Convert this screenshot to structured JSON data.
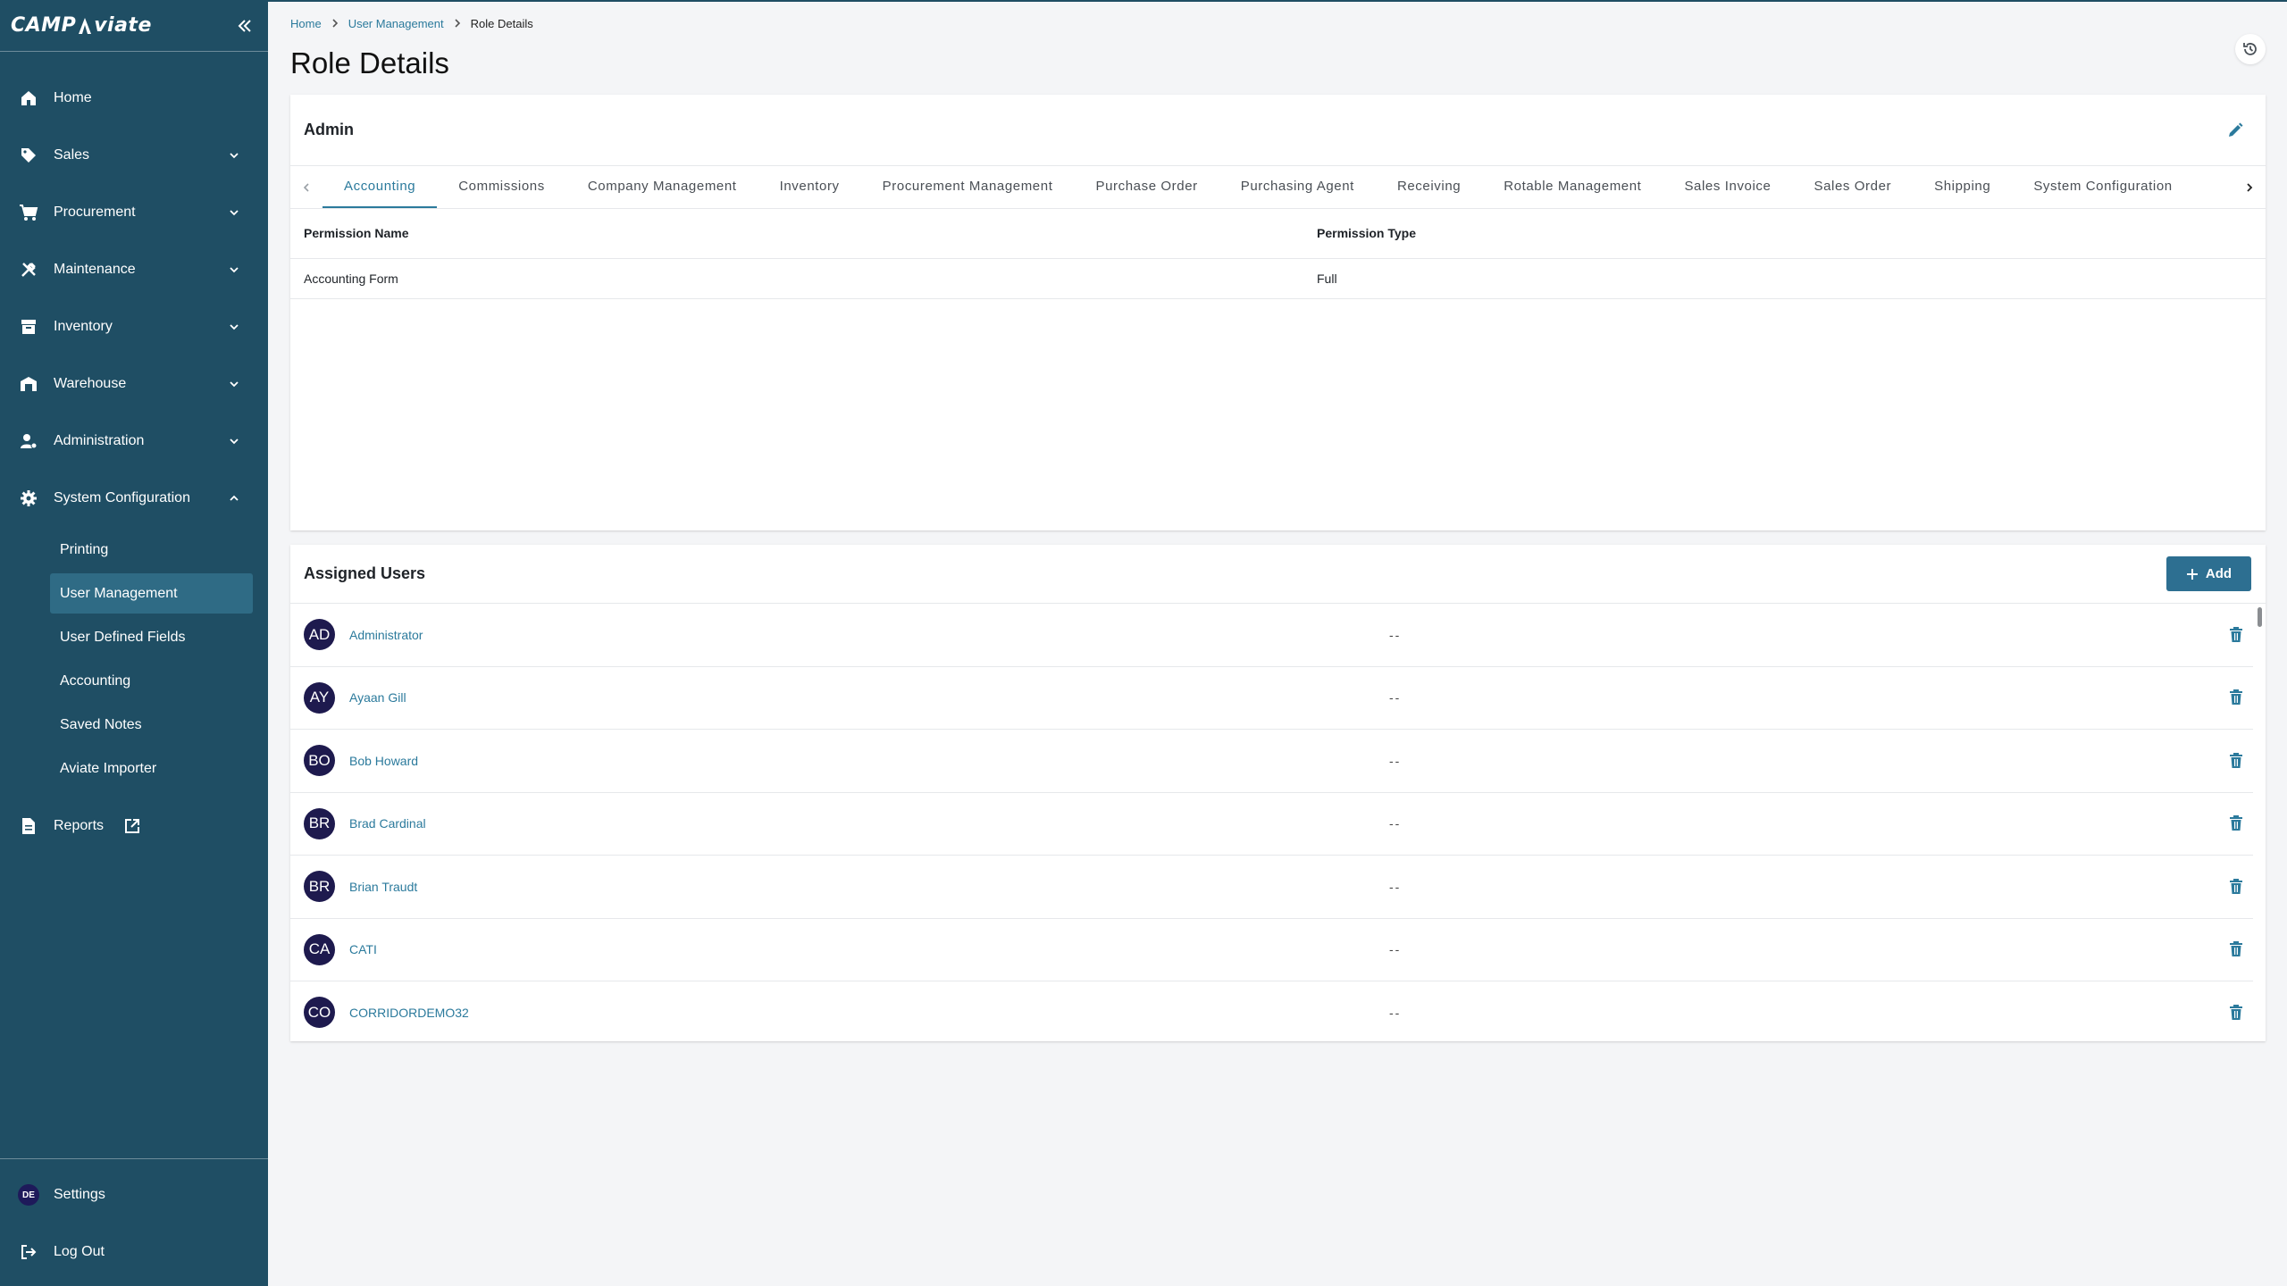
{
  "app": {
    "logo_text_left": "CAMP",
    "logo_text_right": "viate"
  },
  "sidebar": {
    "items": [
      {
        "label": "Home",
        "icon": "home-icon"
      },
      {
        "label": "Sales",
        "icon": "tag-icon"
      },
      {
        "label": "Procurement",
        "icon": "cart-icon"
      },
      {
        "label": "Maintenance",
        "icon": "tools-icon"
      },
      {
        "label": "Inventory",
        "icon": "archive-icon"
      },
      {
        "label": "Warehouse",
        "icon": "warehouse-icon"
      },
      {
        "label": "Administration",
        "icon": "admin-icon"
      },
      {
        "label": "System Configuration",
        "icon": "gear-icon"
      }
    ],
    "sub_items": [
      {
        "label": "Printing"
      },
      {
        "label": "User Management"
      },
      {
        "label": "User Defined Fields"
      },
      {
        "label": "Accounting"
      },
      {
        "label": "Saved Notes"
      },
      {
        "label": "Aviate Importer"
      }
    ],
    "reports_label": "Reports",
    "settings_label": "Settings",
    "settings_avatar": "DE",
    "logout_label": "Log Out"
  },
  "breadcrumb": {
    "home": "Home",
    "user_management": "User Management",
    "current": "Role Details"
  },
  "page": {
    "title": "Role Details"
  },
  "role": {
    "name": "Admin",
    "tabs": [
      "Accounting",
      "Commissions",
      "Company Management",
      "Inventory",
      "Procurement Management",
      "Purchase Order",
      "Purchasing Agent",
      "Receiving",
      "Rotable Management",
      "Sales Invoice",
      "Sales Order",
      "Shipping",
      "System Configuration"
    ],
    "active_tab": "Accounting",
    "table": {
      "headers": [
        "Permission Name",
        "Permission Type"
      ],
      "rows": [
        {
          "name": "Accounting Form",
          "type": "Full"
        }
      ]
    }
  },
  "assigned_users": {
    "title": "Assigned Users",
    "add_label": "Add",
    "users": [
      {
        "initials": "AD",
        "name": "Administrator",
        "extra": "--"
      },
      {
        "initials": "AY",
        "name": "Ayaan Gill",
        "extra": "--"
      },
      {
        "initials": "BO",
        "name": "Bob Howard",
        "extra": "--"
      },
      {
        "initials": "BR",
        "name": "Brad Cardinal",
        "extra": "--"
      },
      {
        "initials": "BR",
        "name": "Brian Traudt",
        "extra": "--"
      },
      {
        "initials": "CA",
        "name": "CATI",
        "extra": "--"
      },
      {
        "initials": "CO",
        "name": "CORRIDORDEMO32",
        "extra": "--"
      }
    ]
  },
  "colors": {
    "sidebar_bg": "#1f4e64",
    "sidebar_active": "#2f6b85",
    "accent": "#2b7a9c",
    "button": "#2d6f91",
    "avatar": "#1e1a4e"
  }
}
